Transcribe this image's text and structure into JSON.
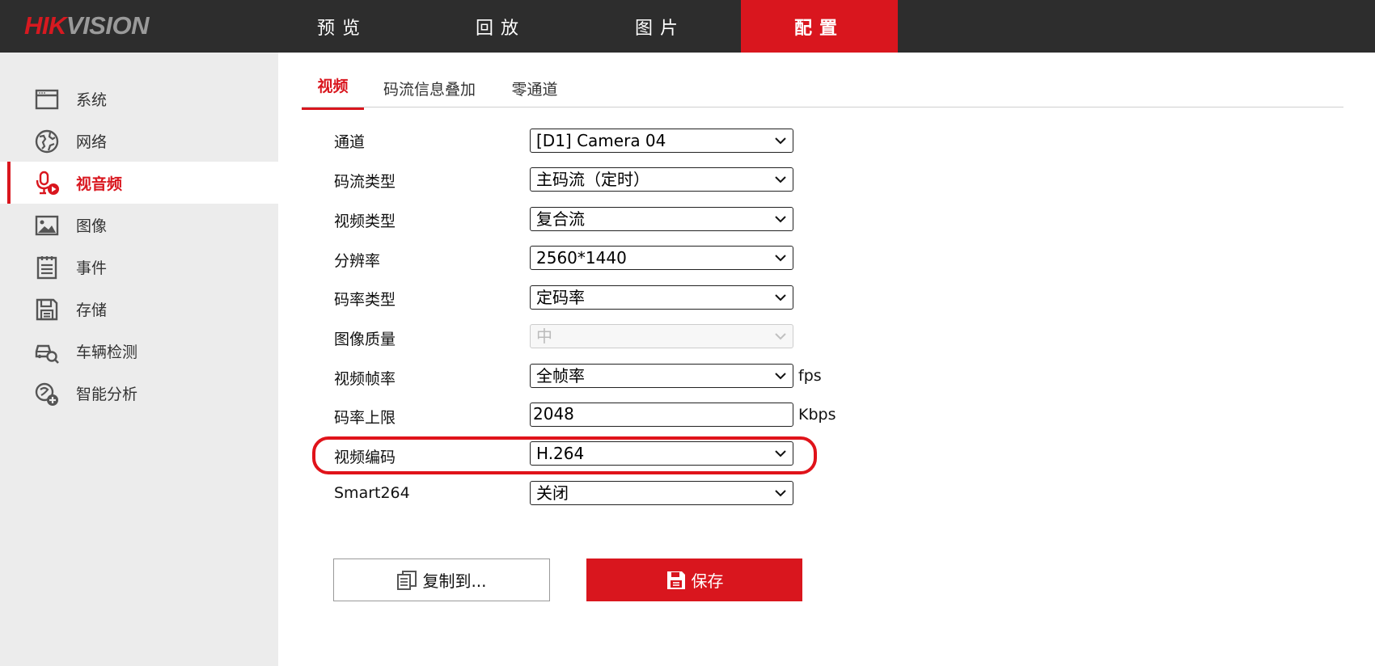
{
  "brand": {
    "logo_hik": "HIK",
    "logo_vision": "VISION"
  },
  "nav": {
    "items": [
      {
        "label": "预览"
      },
      {
        "label": "回放"
      },
      {
        "label": "图片"
      },
      {
        "label": "配置"
      }
    ],
    "active": "配置"
  },
  "sidebar": {
    "items": [
      {
        "label": "系统",
        "icon": "window-icon"
      },
      {
        "label": "网络",
        "icon": "globe-icon"
      },
      {
        "label": "视音频",
        "icon": "mic-video-icon"
      },
      {
        "label": "图像",
        "icon": "image-icon"
      },
      {
        "label": "事件",
        "icon": "list-icon"
      },
      {
        "label": "存储",
        "icon": "floppy-icon"
      },
      {
        "label": "车辆检测",
        "icon": "car-search-icon"
      },
      {
        "label": "智能分析",
        "icon": "analysis-icon"
      }
    ],
    "active": "视音频"
  },
  "tabs": [
    {
      "label": "视频"
    },
    {
      "label": "码流信息叠加"
    },
    {
      "label": "零通道"
    }
  ],
  "form": {
    "channel": {
      "label": "通道",
      "value": "[D1] Camera 04"
    },
    "stream_type": {
      "label": "码流类型",
      "value": "主码流（定时）"
    },
    "video_type": {
      "label": "视频类型",
      "value": "复合流"
    },
    "resolution": {
      "label": "分辨率",
      "value": "2560*1440"
    },
    "bitrate_type": {
      "label": "码率类型",
      "value": "定码率"
    },
    "image_quality": {
      "label": "图像质量",
      "value": "中"
    },
    "frame_rate": {
      "label": "视频帧率",
      "value": "全帧率",
      "unit": "fps"
    },
    "max_bitrate": {
      "label": "码率上限",
      "value": "2048",
      "unit": "Kbps"
    },
    "video_encoding": {
      "label": "视频编码",
      "value": "H.264"
    },
    "smart264": {
      "label": "Smart264",
      "value": "关闭"
    }
  },
  "buttons": {
    "copy_label": "复制到...",
    "save_label": "保存"
  },
  "colors": {
    "accent": "#d9161e",
    "topbar": "#2d2d2d",
    "sidebar": "#ececec",
    "highlight": "#e0131a"
  }
}
